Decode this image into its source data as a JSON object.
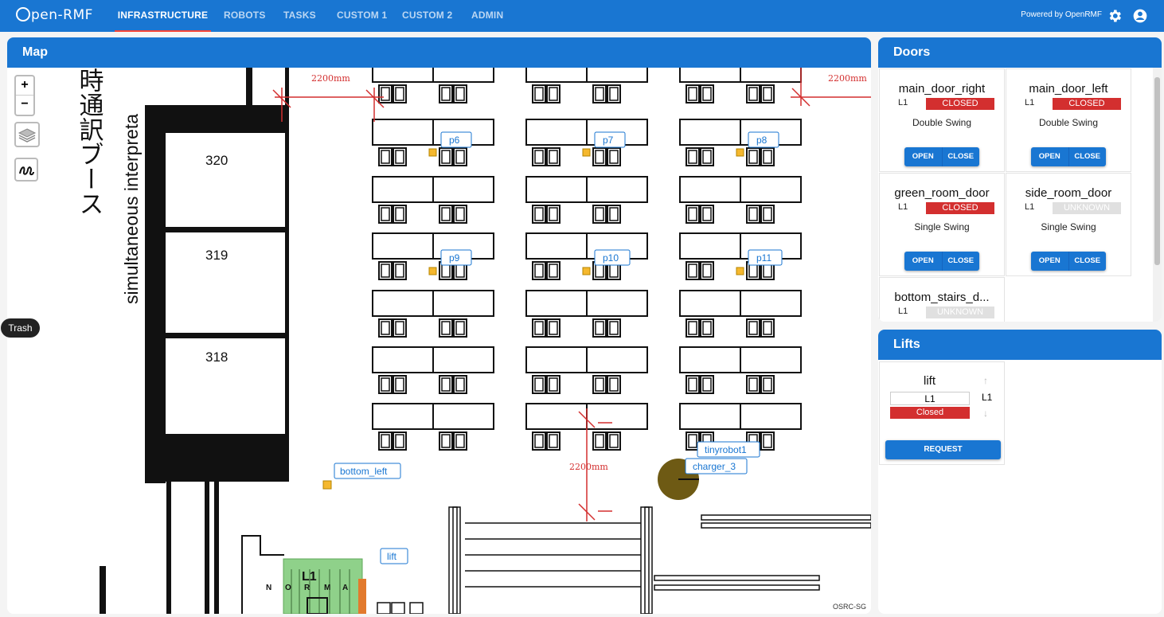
{
  "appbar": {
    "logo": "pen-RMF",
    "tabs": [
      "INFRASTRUCTURE",
      "ROBOTS",
      "TASKS",
      "CUSTOM 1",
      "CUSTOM 2",
      "ADMIN"
    ],
    "active_tab": "INFRASTRUCTURE",
    "powered_by": "Powered by OpenRMF",
    "icons": [
      "settings-gear-icon",
      "account-circle-icon"
    ],
    "color": "#1976d2"
  },
  "map": {
    "title": "Map",
    "zoom_in": "+",
    "zoom_out": "−",
    "trash_label": "Trash",
    "attribution": "OSRC-SG",
    "rooms": [
      "320",
      "319",
      "318"
    ],
    "vertical_text_jp": "時通訳ブース",
    "vertical_text_en": "simultaneous interpreta",
    "dimension_label": "2200mm",
    "waypoints": [
      "p6",
      "p7",
      "p8",
      "p9",
      "p10",
      "p11",
      "bottom_left",
      "tinyrobot1",
      "charger_3",
      "lift"
    ],
    "lift_overlay": {
      "level": "L1",
      "letters": [
        "N",
        "O",
        "R",
        "M",
        "A"
      ]
    }
  },
  "doors": {
    "title": "Doors",
    "open_label": "OPEN",
    "close_label": "CLOSE",
    "items": [
      {
        "name": "main_door_right",
        "level": "L1",
        "state": "CLOSED",
        "motion": "Double Swing"
      },
      {
        "name": "main_door_left",
        "level": "L1",
        "state": "CLOSED",
        "motion": "Double Swing"
      },
      {
        "name": "green_room_door",
        "level": "L1",
        "state": "CLOSED",
        "motion": "Single Swing"
      },
      {
        "name": "side_room_door",
        "level": "L1",
        "state": "UNKNOWN",
        "motion": "Single Swing"
      },
      {
        "name": "bottom_stairs_d...",
        "level": "L1",
        "state": "UNKNOWN",
        "motion": ""
      }
    ]
  },
  "lifts": {
    "title": "Lifts",
    "items": [
      {
        "name": "lift",
        "level": "L1",
        "state": "Closed",
        "current_level": "L1",
        "request_label": "REQUEST"
      }
    ]
  },
  "colors": {
    "closed": "#d32f2f",
    "unknown": "#e0e0e0",
    "robot": "#6e5a14",
    "waypoint": "#f5b82e",
    "lift_zone": "#8fd18a"
  }
}
